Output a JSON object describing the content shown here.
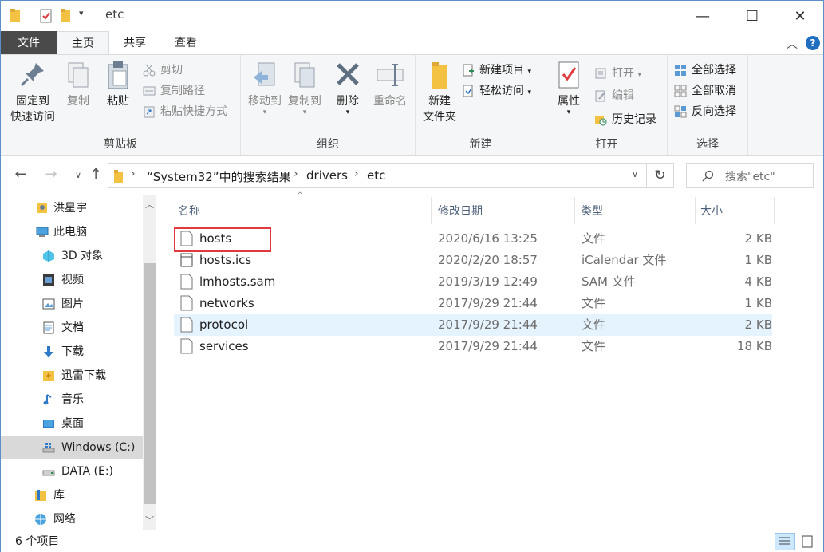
{
  "window": {
    "title": "etc",
    "controls": {
      "minimize": "—",
      "maximize": "☐",
      "close": "✕"
    }
  },
  "ribbon": {
    "tabs": {
      "file": "文件",
      "home": "主页",
      "share": "共享",
      "view": "查看"
    },
    "clipboard": {
      "label": "剪贴板",
      "pin": "固定到\n快速访问",
      "pin_line1": "固定到",
      "pin_line2": "快速访问",
      "copy": "复制",
      "paste": "粘贴",
      "cut": "剪切",
      "copy_path": "复制路径",
      "paste_shortcut": "粘贴快捷方式"
    },
    "organize": {
      "label": "组织",
      "move_to": "移动到",
      "copy_to": "复制到",
      "delete": "删除",
      "rename": "重命名"
    },
    "new": {
      "label": "新建",
      "new_folder_line1": "新建",
      "new_folder_line2": "文件夹",
      "new_item": "新建项目",
      "easy_access": "轻松访问"
    },
    "open": {
      "label": "打开",
      "properties": "属性",
      "open": "打开",
      "edit": "编辑",
      "history": "历史记录"
    },
    "select": {
      "label": "选择",
      "select_all": "全部选择",
      "select_none": "全部取消",
      "invert": "反向选择"
    }
  },
  "address": {
    "crumbs": [
      "“System32”中的搜索结果",
      "drivers",
      "etc"
    ],
    "search_placeholder": "搜索\"etc\""
  },
  "nav": {
    "items": [
      {
        "label": "洪星宇",
        "icon": "user-icon"
      },
      {
        "label": "此电脑",
        "icon": "computer-icon"
      },
      {
        "label": "3D 对象",
        "icon": "3d-objects-icon"
      },
      {
        "label": "视频",
        "icon": "video-icon"
      },
      {
        "label": "图片",
        "icon": "pictures-icon"
      },
      {
        "label": "文档",
        "icon": "documents-icon"
      },
      {
        "label": "下载",
        "icon": "downloads-icon"
      },
      {
        "label": "迅雷下载",
        "icon": "folder-icon"
      },
      {
        "label": "音乐",
        "icon": "music-icon"
      },
      {
        "label": "桌面",
        "icon": "desktop-icon"
      },
      {
        "label": "Windows (C:)",
        "icon": "windows-drive-icon"
      },
      {
        "label": "DATA (E:)",
        "icon": "drive-icon"
      },
      {
        "label": "库",
        "icon": "library-icon"
      },
      {
        "label": "网络",
        "icon": "network-icon"
      }
    ]
  },
  "files": {
    "columns": {
      "name": "名称",
      "modified": "修改日期",
      "type": "类型",
      "size": "大小"
    },
    "rows": [
      {
        "name": "hosts",
        "modified": "2020/6/16 13:25",
        "type": "文件",
        "size": "2 KB"
      },
      {
        "name": "hosts.ics",
        "modified": "2020/2/20 18:57",
        "type": "iCalendar 文件",
        "size": "1 KB"
      },
      {
        "name": "lmhosts.sam",
        "modified": "2019/3/19 12:49",
        "type": "SAM 文件",
        "size": "4 KB"
      },
      {
        "name": "networks",
        "modified": "2017/9/29 21:44",
        "type": "文件",
        "size": "1 KB"
      },
      {
        "name": "protocol",
        "modified": "2017/9/29 21:44",
        "type": "文件",
        "size": "2 KB"
      },
      {
        "name": "services",
        "modified": "2017/9/29 21:44",
        "type": "文件",
        "size": "18 KB"
      }
    ]
  },
  "status": {
    "count": "6 个项目"
  },
  "colors": {
    "accent": "#1f6ec0",
    "highlight": "#e0393e",
    "hover_row": "#e5f3ff",
    "folder": "#f3c243"
  }
}
